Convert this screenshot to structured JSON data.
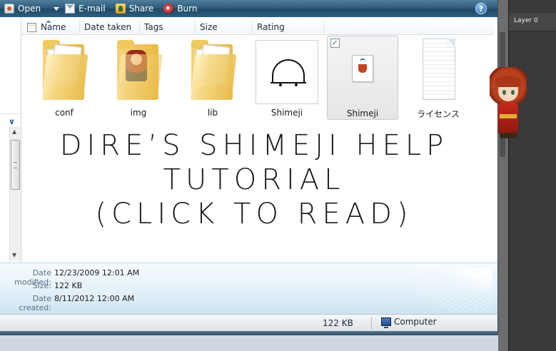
{
  "toolbar": {
    "open_label": "Open",
    "email_label": "E-mail",
    "share_label": "Share",
    "burn_label": "Burn",
    "help_label": "?"
  },
  "columns": {
    "name": "Name",
    "date_taken": "Date taken",
    "tags": "Tags",
    "size": "Size",
    "rating": "Rating"
  },
  "files": [
    {
      "label": "conf",
      "icon": "folder-icon",
      "selected": false
    },
    {
      "label": "img",
      "icon": "folder-icon",
      "selected": false
    },
    {
      "label": "lib",
      "icon": "folder-icon",
      "selected": false
    },
    {
      "label": "Shimeji",
      "icon": "shimeji-executable-icon",
      "selected": false
    },
    {
      "label": "Shimeji",
      "icon": "java-jar-icon",
      "selected": true
    },
    {
      "label": "ライセンス",
      "icon": "text-document-icon",
      "selected": false
    }
  ],
  "overlay_title": {
    "line1": "DIRE’S SHIMEJI HELP",
    "line2": "TUTORIAL",
    "line3": "(CLICK TO READ)"
  },
  "details": {
    "date_modified_label": "Date modified:",
    "date_modified_value": "12/23/2009 12:01 AM",
    "size_label": "Size:",
    "size_value": "122 KB",
    "date_created_label": "Date created:",
    "date_created_value": "8/11/2012 12:00 AM"
  },
  "statusbar": {
    "size": "122 KB",
    "location": "Computer"
  },
  "layers_panel": {
    "layer_name": "Layer 0"
  },
  "colors": {
    "toolbar_top": "#4f7f9c",
    "toolbar_bottom": "#1f4966",
    "details_bg": "#e4f1f9",
    "panel_bg": "#3a3a3a"
  }
}
